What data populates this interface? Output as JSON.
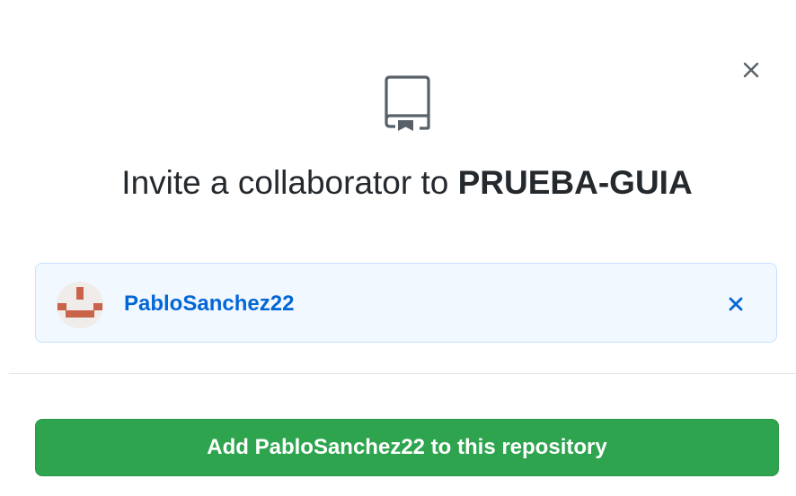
{
  "dialog": {
    "title_prefix": "Invite a collaborator to ",
    "repo_name": "PRUEBA-GUIA",
    "close_icon": "close-icon",
    "repo_icon": "repo-icon"
  },
  "selected_user": {
    "username": "PabloSanchez22",
    "avatar_icon": "avatar",
    "remove_icon": "close-icon"
  },
  "actions": {
    "add_label": "Add PabloSanchez22 to this repository"
  },
  "colors": {
    "primary_button": "#2ea44f",
    "link": "#0366d6",
    "selection_bg": "#f1f8ff",
    "selection_border": "#c8e1ff",
    "avatar_pixels": "#c9644a"
  }
}
